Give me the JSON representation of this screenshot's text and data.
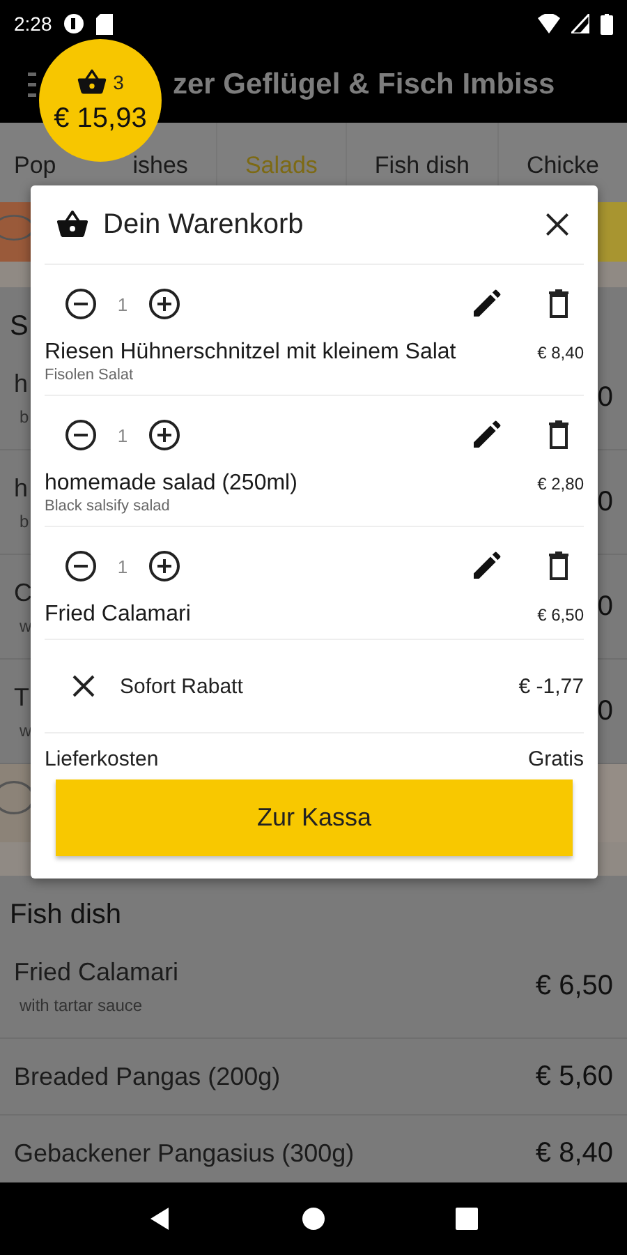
{
  "status_bar": {
    "time": "2:28"
  },
  "app_bar": {
    "title": "zer Geflügel & Fisch Imbiss"
  },
  "cart_badge": {
    "count": "3",
    "total": "€ 15,93"
  },
  "tabs": [
    {
      "label_start": "Pop",
      "label_end": "ishes",
      "selected": false
    },
    {
      "label": "Salads",
      "selected": true
    },
    {
      "label": "Fish dish",
      "selected": false
    },
    {
      "label": "Chicke",
      "selected": false
    }
  ],
  "menu_behind": [
    {
      "kind": "picture"
    },
    {
      "kind": "header",
      "name": "S"
    },
    {
      "kind": "item",
      "name": "h",
      "note": "b",
      "price": "0"
    },
    {
      "kind": "item",
      "name": "h",
      "note": "b",
      "price": "0"
    },
    {
      "kind": "item",
      "name": "C",
      "note": "w",
      "price": "0"
    },
    {
      "kind": "item",
      "name": "T",
      "note": "w",
      "price": "0"
    },
    {
      "kind": "picture"
    },
    {
      "kind": "header",
      "name": "Fish dish"
    },
    {
      "kind": "item",
      "name": "Fried Calamari",
      "note": "with tartar sauce",
      "price": "€ 6,50"
    },
    {
      "kind": "item",
      "name": "Breaded Pangas (200g)",
      "price": "€ 5,60"
    },
    {
      "kind": "item",
      "name": "Gebackener Pangasius (300g)",
      "price": "€ 8,40"
    }
  ],
  "cart": {
    "title": "Dein Warenkorb",
    "items": [
      {
        "quantity": "1",
        "name": "Riesen Hühnerschnitzel mit kleinem Salat",
        "note": "Fisolen Salat",
        "price": "€ 8,40"
      },
      {
        "quantity": "1",
        "name": "homemade salad (250ml)",
        "note": "Black salsify salad",
        "price": "€ 2,80"
      },
      {
        "quantity": "1",
        "name": "Fried Calamari",
        "price": "€ 6,50"
      }
    ],
    "discount": {
      "label": "Sofort Rabatt",
      "amount": "€ -1,77"
    },
    "delivery": {
      "label": "Lieferkosten",
      "value": "Gratis"
    },
    "checkout": "Zur Kassa"
  }
}
